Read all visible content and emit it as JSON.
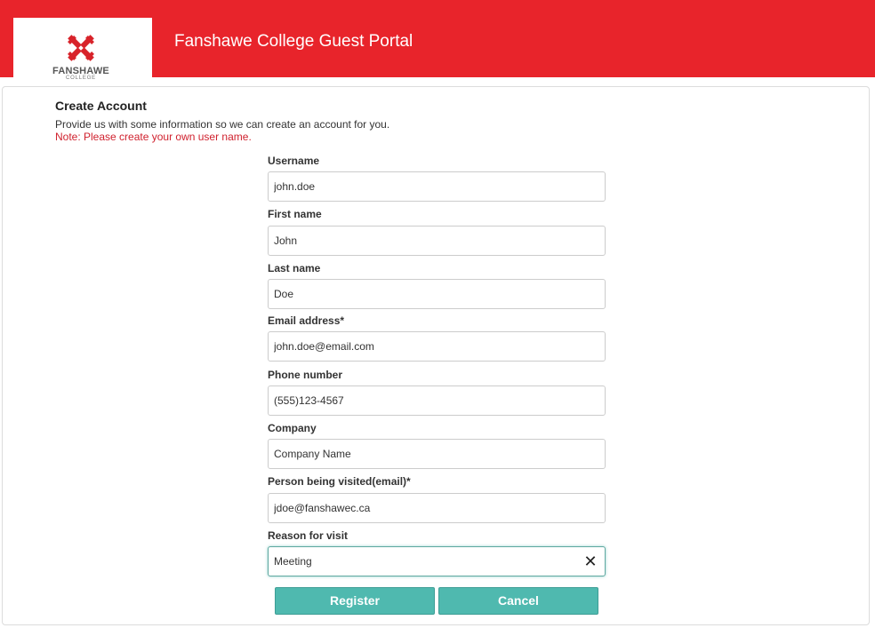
{
  "header": {
    "title": "Fanshawe College Guest Portal",
    "logo_text": "FANSHAWE",
    "logo_subtext": "COLLEGE",
    "brand_color": "#e8242b"
  },
  "form": {
    "title": "Create Account",
    "intro": "Provide us with some information so we can create an account for you.",
    "note": "Note: Please create your own user name.",
    "fields": {
      "username": {
        "label": "Username",
        "value": "john.doe"
      },
      "first_name": {
        "label": "First name",
        "value": "John"
      },
      "last_name": {
        "label": "Last name",
        "value": "Doe"
      },
      "email": {
        "label": "Email address*",
        "value": "john.doe@email.com"
      },
      "phone": {
        "label": "Phone number",
        "value": "(555)123-4567"
      },
      "company": {
        "label": "Company",
        "value": "Company Name"
      },
      "person_visited": {
        "label": "Person being visited(email)*",
        "value": "jdoe@fanshawec.ca"
      },
      "reason": {
        "label": "Reason for visit",
        "value": "Meeting"
      }
    },
    "clear_icon": "close-icon",
    "register_label": "Register",
    "cancel_label": "Cancel",
    "button_color": "#4fb9af"
  }
}
